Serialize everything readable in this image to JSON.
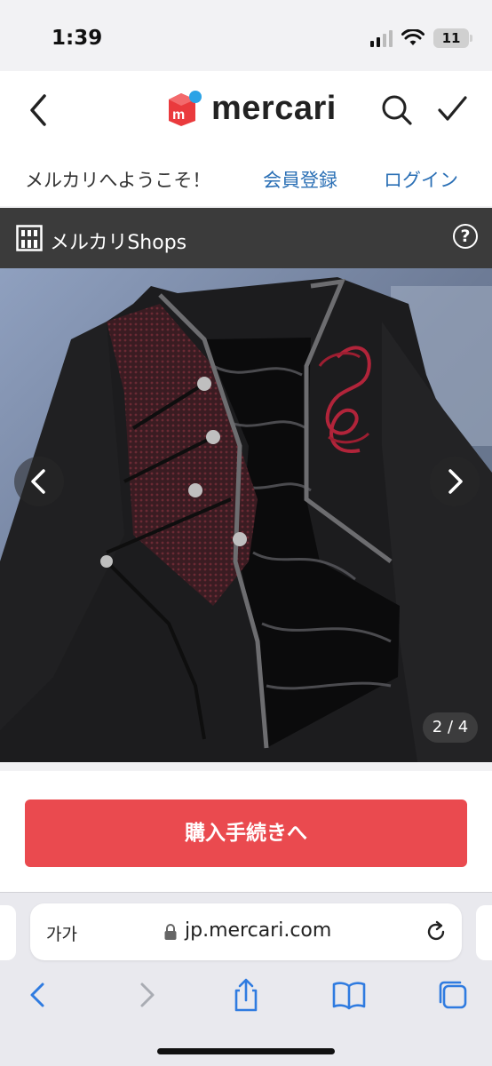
{
  "status_bar": {
    "time": "1:39",
    "battery": "11"
  },
  "header": {
    "logo_text": "mercari",
    "logo_mark": "m",
    "brand_color": "#ea3a3d",
    "accent_color": "#2ba3e6"
  },
  "welcome": {
    "text": "メルカリへようこそ！",
    "register": "会員登録",
    "login": "ログイン",
    "link_color": "#2a6fb5"
  },
  "shops_bar": {
    "label": "メルカリShops",
    "help": "?"
  },
  "gallery": {
    "counter": "2 / 4",
    "current": 2,
    "total": 4
  },
  "purchase": {
    "label": "購入手続きへ",
    "color": "#ea4a4f"
  },
  "browser": {
    "text_size_label": "가가",
    "url": "jp.mercari.com"
  },
  "toolbar": {
    "items": [
      "back-icon",
      "forward-icon",
      "share-icon",
      "bookmarks-icon",
      "tabs-icon"
    ],
    "accent_color": "#2f7be0"
  }
}
